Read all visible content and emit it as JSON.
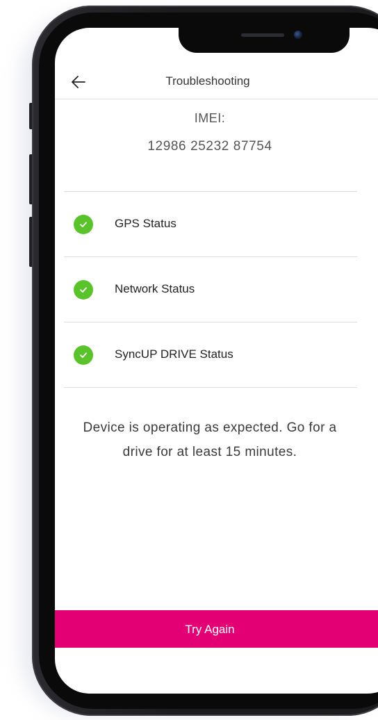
{
  "header": {
    "title": "Troubleshooting",
    "back_icon": "arrow-left-icon"
  },
  "device": {
    "imei_label": "IMEI:",
    "imei_value": "12986 25232 87754"
  },
  "status_items": [
    {
      "label": "GPS Status",
      "state": "ok",
      "icon": "check-circle-icon"
    },
    {
      "label": "Network Status",
      "state": "ok",
      "icon": "check-circle-icon"
    },
    {
      "label": "SyncUP DRIVE Status",
      "state": "ok",
      "icon": "check-circle-icon"
    }
  ],
  "message": "Device is operating as expected. Go for a drive for at least 15 minutes.",
  "actions": {
    "try_again_label": "Try Again"
  },
  "colors": {
    "accent": "#e20074",
    "success": "#5ac32c"
  }
}
